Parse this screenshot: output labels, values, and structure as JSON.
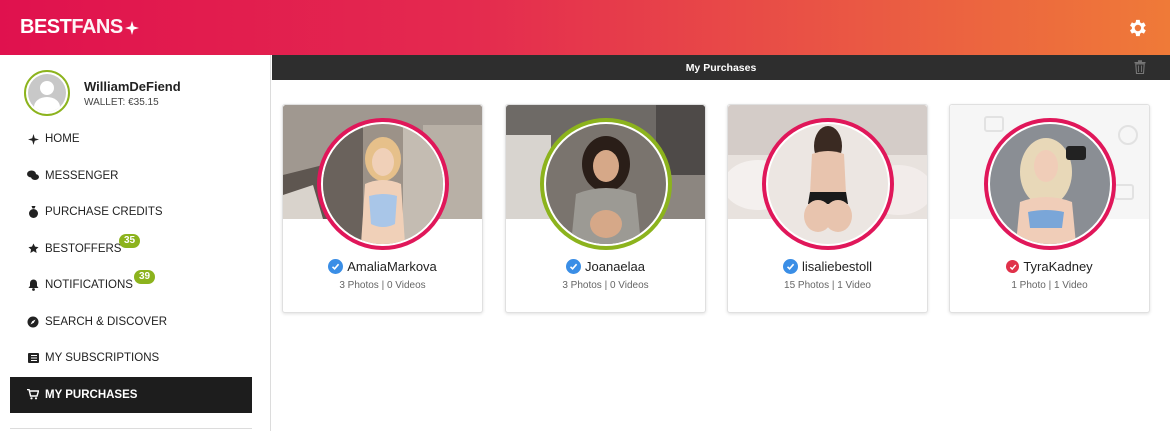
{
  "header": {
    "logo_part1": "BEST",
    "logo_part2": "FANS",
    "settings_icon": "gear-icon"
  },
  "colors": {
    "brand_gradient_start": "#e0114e",
    "brand_gradient_end": "#ef7a38",
    "accent_green": "#8cb31d",
    "ring_pink": "#e0175a",
    "active_nav_bg": "#1d1d1d",
    "verified_blue": "#3a8ee6"
  },
  "profile": {
    "username": "WilliamDeFiend",
    "wallet": "WALLET: €35.15"
  },
  "sidebar": {
    "items": [
      {
        "label": "HOME",
        "icon": "star-icon"
      },
      {
        "label": "MESSENGER",
        "icon": "chat-icon"
      },
      {
        "label": "PURCHASE CREDITS",
        "icon": "money-bag-icon"
      },
      {
        "label": "BESTOFFERS",
        "icon": "star-icon",
        "badge": "35"
      },
      {
        "label": "NOTIFICATIONS",
        "icon": "bell-icon",
        "badge": "39"
      },
      {
        "label": "SEARCH & DISCOVER",
        "icon": "compass-icon"
      },
      {
        "label": "MY SUBSCRIPTIONS",
        "icon": "list-icon"
      },
      {
        "label": "MY PURCHASES",
        "icon": "cart-icon",
        "active": true
      }
    ]
  },
  "main": {
    "title": "My Purchases",
    "trash_icon": "trash-icon"
  },
  "purchases": [
    {
      "name": "AmaliaMarkova",
      "stats": "3 Photos | 0 Videos",
      "ring": "pink",
      "verified": "blue"
    },
    {
      "name": "Joanaelaa",
      "stats": "3 Photos | 0 Videos",
      "ring": "green",
      "verified": "blue"
    },
    {
      "name": "lisaliebestoll",
      "stats": "15 Photos | 1 Video",
      "ring": "pink",
      "verified": "blue"
    },
    {
      "name": "TyraKadney",
      "stats": "1 Photo | 1 Video",
      "ring": "pink",
      "verified": "red"
    }
  ]
}
